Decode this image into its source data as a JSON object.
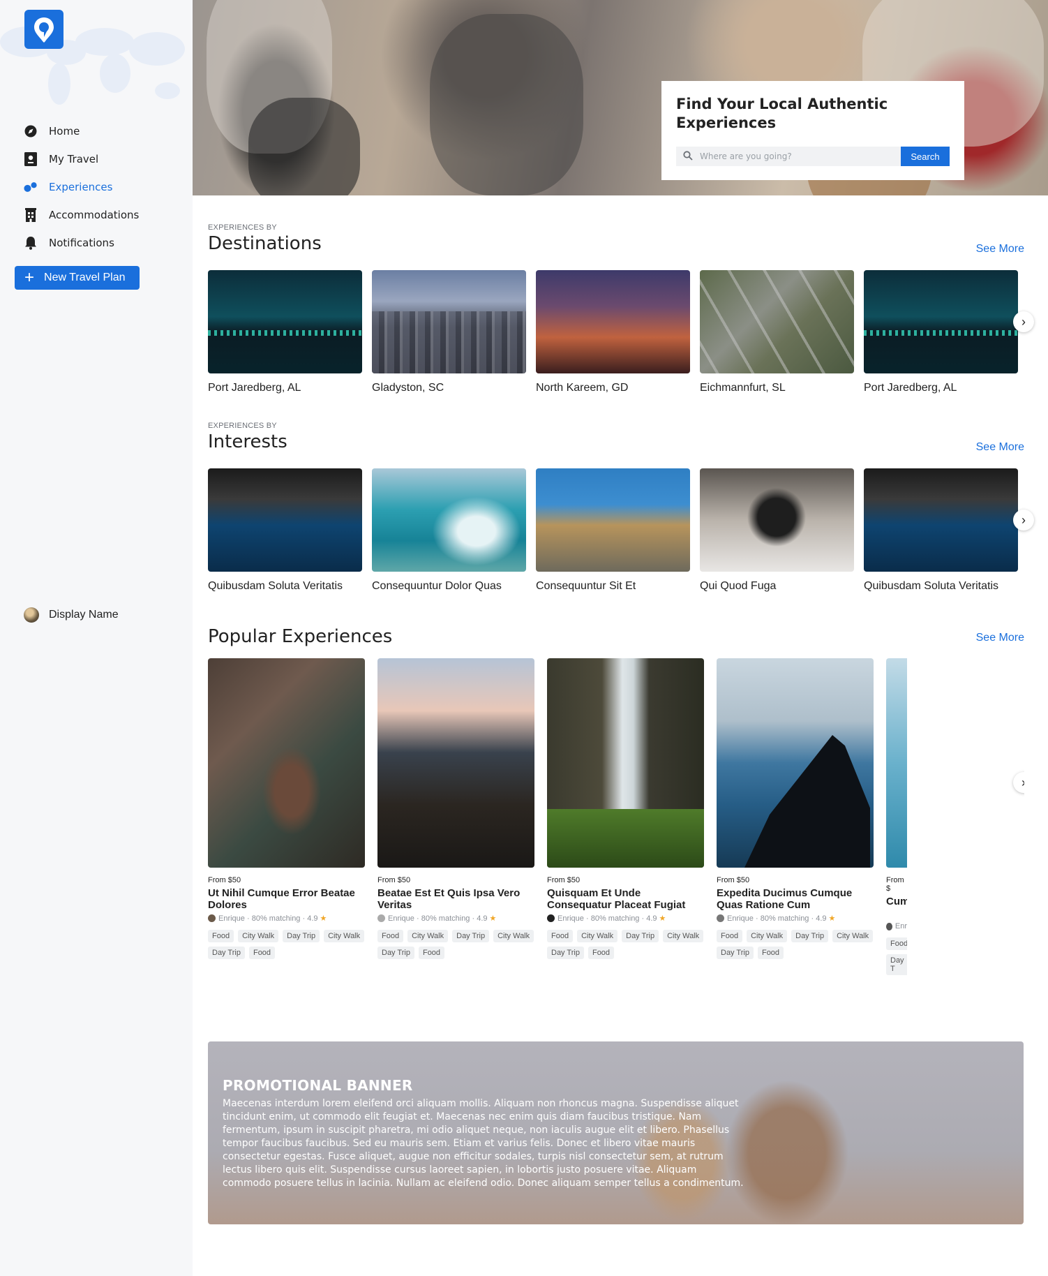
{
  "nav": {
    "items": [
      {
        "label": "Home",
        "icon": "compass-icon"
      },
      {
        "label": "My Travel",
        "icon": "passport-icon"
      },
      {
        "label": "Experiences",
        "icon": "experiences-icon"
      },
      {
        "label": "Accommodations",
        "icon": "building-icon"
      },
      {
        "label": "Notifications",
        "icon": "bell-icon"
      }
    ],
    "active": "Experiences",
    "new_plan_label": "New Travel Plan",
    "profile_name": "Display Name"
  },
  "hero": {
    "title": "Find Your Local Authentic Experiences",
    "search_placeholder": "Where are you going?",
    "search_button": "Search"
  },
  "destinations": {
    "eyebrow": "EXPERIENCES BY",
    "title": "Destinations",
    "see_more": "See More",
    "items": [
      {
        "label": "Port Jaredberg, AL"
      },
      {
        "label": "Gladyston, SC"
      },
      {
        "label": "North Kareem, GD"
      },
      {
        "label": "Eichmannfurt, SL"
      },
      {
        "label": "Port Jaredberg, AL"
      }
    ]
  },
  "interests": {
    "eyebrow": "EXPERIENCES BY",
    "title": "Interests",
    "see_more": "See More",
    "items": [
      {
        "label": "Quibusdam Soluta Veritatis"
      },
      {
        "label": "Consequuntur Dolor Quas"
      },
      {
        "label": "Consequuntur Sit Et"
      },
      {
        "label": "Qui Quod Fuga"
      },
      {
        "label": "Quibusdam Soluta Veritatis"
      }
    ]
  },
  "popular": {
    "title": "Popular Experiences",
    "see_more": "See More",
    "items": [
      {
        "price": "From $50",
        "title": "Ut Nihil Cumque Error Beatae Dolores",
        "host": "Enrique",
        "matching": "80% matching",
        "rating": "4.9",
        "tags": [
          "Food",
          "City Walk",
          "Day Trip",
          "City Walk",
          "Day Trip",
          "Food"
        ]
      },
      {
        "price": "From $50",
        "title": "Beatae Est Et Quis Ipsa Vero Veritas",
        "host": "Enrique",
        "matching": "80% matching",
        "rating": "4.9",
        "tags": [
          "Food",
          "City Walk",
          "Day Trip",
          "City Walk",
          "Day Trip",
          "Food"
        ]
      },
      {
        "price": "From $50",
        "title": "Quisquam Et Unde Consequatur Placeat Fugiat",
        "host": "Enrique",
        "matching": "80% matching",
        "rating": "4.9",
        "tags": [
          "Food",
          "City Walk",
          "Day Trip",
          "City Walk",
          "Day Trip",
          "Food"
        ]
      },
      {
        "price": "From $50",
        "title": "Expedita Ducimus Cumque Quas Ratione Cum",
        "host": "Enrique",
        "matching": "80% matching",
        "rating": "4.9",
        "tags": [
          "Food",
          "City Walk",
          "Day Trip",
          "City Walk",
          "Day Trip",
          "Food"
        ]
      },
      {
        "price": "From $",
        "title": "Cum",
        "host": "Enr",
        "matching": "",
        "rating": "",
        "tags": [
          "Food",
          "Day T"
        ]
      }
    ],
    "separator": "·",
    "star": "★"
  },
  "promo": {
    "title": "PROMOTIONAL BANNER",
    "body": "Maecenas interdum lorem eleifend orci aliquam mollis. Aliquam non rhoncus magna. Suspendisse aliquet tincidunt enim, ut commodo elit feugiat et. Maecenas nec enim quis diam faucibus tristique. Nam fermentum, ipsum in suscipit pharetra, mi odio aliquet neque, non iaculis augue elit et libero. Phasellus tempor faucibus faucibus. Sed eu mauris sem. Etiam et varius felis. Donec et libero vitae mauris consectetur egestas. Fusce aliquet, augue non efficitur sodales, turpis nisl consectetur sem, at rutrum lectus libero quis elit. Suspendisse cursus laoreet sapien, in lobortis justo posuere vitae. Aliquam commodo posuere tellus in lacinia. Nullam ac eleifend odio. Donec aliquam semper tellus a condimentum."
  },
  "colors": {
    "accent": "#1a6fdc",
    "sidebar_bg": "#f6f7f9",
    "star": "#f0a626"
  }
}
